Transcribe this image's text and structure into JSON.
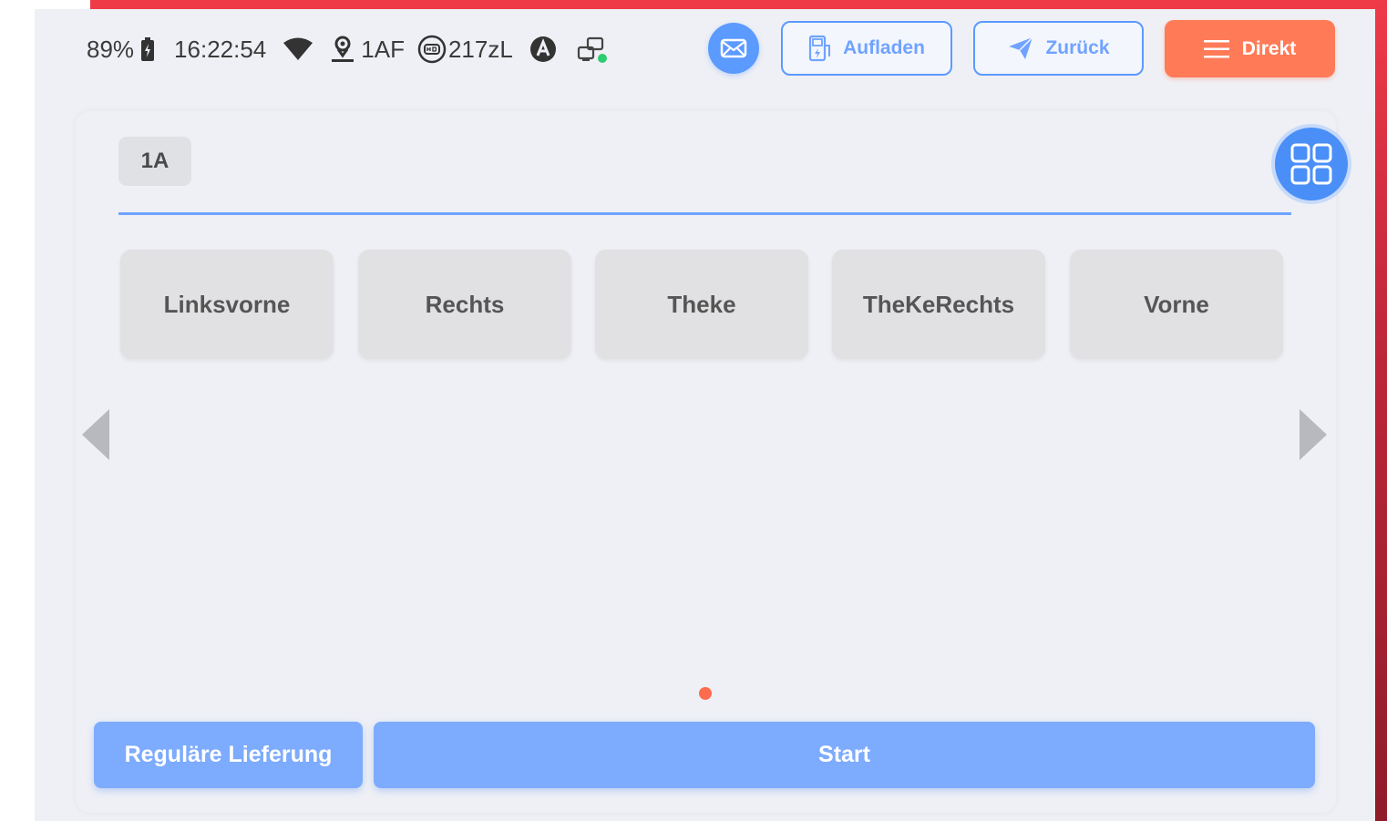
{
  "status_bar": {
    "battery_percent": "89%",
    "time": "16:22:54",
    "location_code": "1AF",
    "volume": "217zL",
    "icons": [
      "battery-icon",
      "wifi-icon",
      "location-icon",
      "hd-icon",
      "a-icon",
      "device-status-icon"
    ]
  },
  "header": {
    "mail_icon": "mail-icon",
    "aufladen_label": "Aufladen",
    "zurueck_label": "Zurück",
    "direkt_label": "Direkt"
  },
  "zone": {
    "selected": "1A"
  },
  "tables": [
    "Linksvorne",
    "Rechts",
    "Theke",
    "TheKeRechts",
    "Vorne"
  ],
  "pagination": {
    "pages": 1,
    "current": 1
  },
  "footer": {
    "regular_label": "Reguläre Lieferung",
    "start_label": "Start"
  },
  "colors": {
    "accent_blue": "#5b9aff",
    "button_blue": "#7dabfd",
    "orange": "#ff7b58",
    "red_frame": "#ef3a48",
    "background": "#eff0f5"
  }
}
